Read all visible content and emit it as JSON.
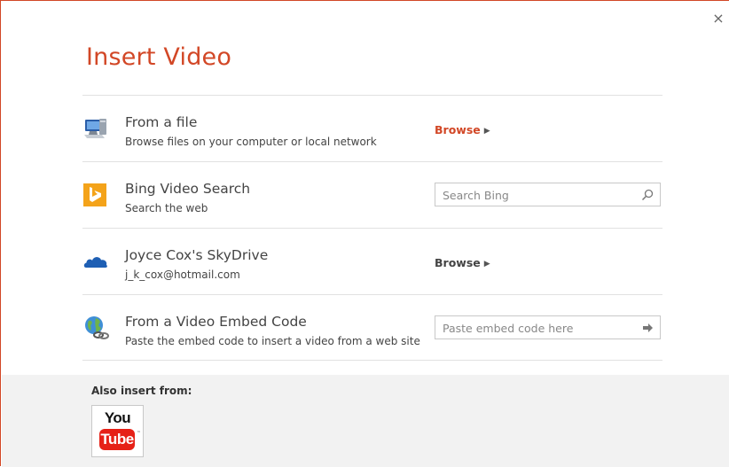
{
  "dialog": {
    "title": "Insert Video",
    "close_glyph": "×"
  },
  "rows": [
    {
      "name": "From a file",
      "description": "Browse files on your computer or local network",
      "action": "Browse",
      "icon": "computer-icon"
    },
    {
      "name": "Bing Video Search",
      "description": "Search the web",
      "search_placeholder": "Search Bing",
      "icon": "bing-icon"
    },
    {
      "name": "Joyce Cox's SkyDrive",
      "description": "j_k_cox@hotmail.com",
      "action": "Browse",
      "icon": "skydrive-icon"
    },
    {
      "name": "From a Video Embed Code",
      "description": "Paste the embed code to insert a video from a web site",
      "embed_placeholder": "Paste embed code here",
      "icon": "globe-link-icon"
    }
  ],
  "footer": {
    "label": "Also insert from:",
    "youtube_top": "You",
    "youtube_bottom": "Tube",
    "youtube_tm": "™"
  },
  "colors": {
    "accent": "#d24726",
    "bing": "#f4a31a",
    "skydrive": "#1e5fb4",
    "youtube_red": "#e62117",
    "footer_bg": "#f2f2f2"
  }
}
